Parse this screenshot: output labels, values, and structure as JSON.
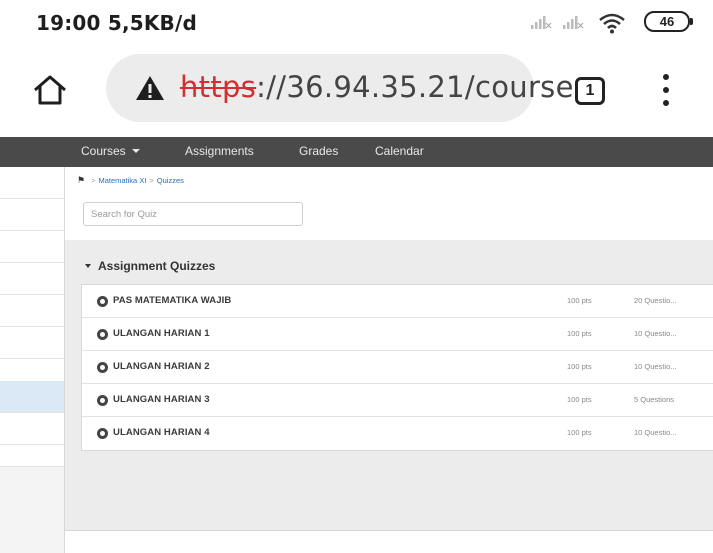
{
  "status_bar": {
    "time_speed": "19:00  5,5KB/d",
    "battery": "46"
  },
  "browser": {
    "url_scheme": "https",
    "url_rest": "://36.94.35.21/course",
    "tab_count": "1",
    "icons": [
      "home-icon",
      "warning-icon",
      "tabs-icon",
      "more-vert-icon"
    ]
  },
  "site_nav": {
    "items": [
      "Courses",
      "Assignments",
      "Grades",
      "Calendar"
    ]
  },
  "breadcrumb": {
    "course": "Matematika XI",
    "page": "Quizzes"
  },
  "search": {
    "placeholder": "Search for Quiz"
  },
  "group": {
    "title": "Assignment Quizzes",
    "quizzes": [
      {
        "title": "PAS MATEMATIKA WAJIB",
        "points": "100 pts",
        "questions": "20 Questio..."
      },
      {
        "title": "ULANGAN HARIAN 1",
        "points": "100 pts",
        "questions": "10 Questio..."
      },
      {
        "title": "ULANGAN HARIAN 2",
        "points": "100 pts",
        "questions": "10 Questio..."
      },
      {
        "title": "ULANGAN HARIAN 3",
        "points": "100 pts",
        "questions": "5 Questions"
      },
      {
        "title": "ULANGAN HARIAN 4",
        "points": "100 pts",
        "questions": "10 Questio..."
      }
    ]
  },
  "colors": {
    "nav_bg": "#4a4a4a",
    "link": "#2a6ebb",
    "url_warning": "#d32f2f",
    "active_row": "#dbe8f5"
  }
}
